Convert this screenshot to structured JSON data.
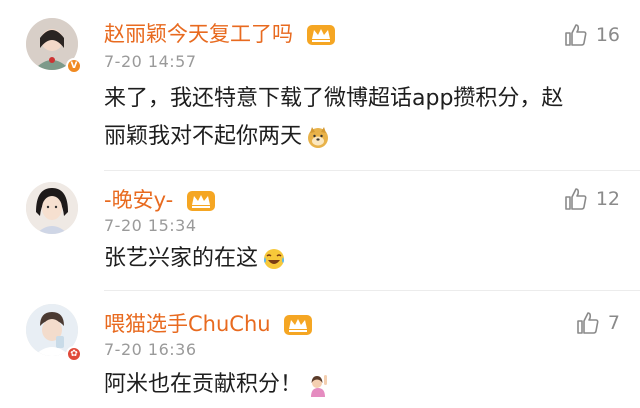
{
  "comments": [
    {
      "username": "赵丽颖今天复工了吗",
      "time": "7-20 14:57",
      "text_line1": "来了，我还特意下载了微博超话app攒积分，赵",
      "text_line2": "丽颖我对不起你两天",
      "likes": "16",
      "emoji": "doge-emoji"
    },
    {
      "username": "-晚安y-",
      "time": "7-20 15:34",
      "text_line1": "张艺兴家的在这",
      "likes": "12",
      "emoji": "laugh-cry-emoji"
    },
    {
      "username": "喂猫选手ChuChu",
      "time": "7-20 16:36",
      "text_line1": "阿米也在贡献积分！",
      "likes": "7",
      "emoji": "raise-hand-emoji"
    }
  ],
  "colors": {
    "username": "#e86a1f",
    "time": "#9a9a9a",
    "like": "#8a8a8a"
  }
}
